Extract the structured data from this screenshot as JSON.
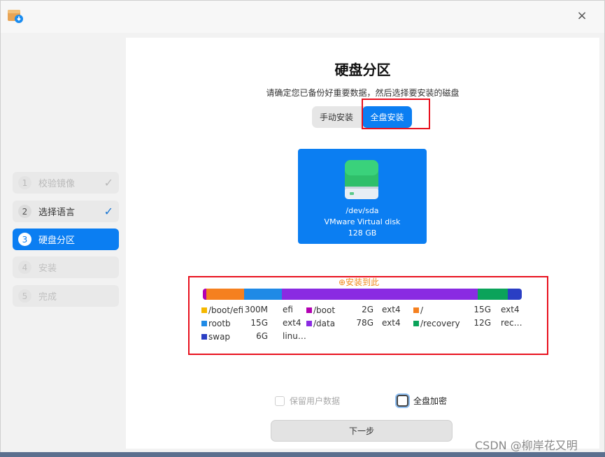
{
  "window": {
    "close_glyph": "×",
    "app_icon": "installer-package-icon"
  },
  "sidebar": {
    "steps": [
      {
        "num": "1",
        "label": "校验镜像",
        "state": "done"
      },
      {
        "num": "2",
        "label": "选择语言",
        "state": "done"
      },
      {
        "num": "3",
        "label": "硬盘分区",
        "state": "active"
      },
      {
        "num": "4",
        "label": "安装",
        "state": "disabled"
      },
      {
        "num": "5",
        "label": "完成",
        "state": "disabled"
      }
    ],
    "check_glyph": "✓"
  },
  "main": {
    "title": "硬盘分区",
    "subtitle": "请确定您已备份好重要数据，然后选择要安装的磁盘",
    "modes": {
      "manual": "手动安装",
      "full": "全盘安装",
      "selected": "全盘安装"
    },
    "disk": {
      "path": "/dev/sda",
      "model": "VMware Virtual disk",
      "size": "128 GB"
    },
    "install_here": "⊕安装到此",
    "partitions": [
      {
        "name": "/boot/efi",
        "size": "300M",
        "fs": "efi",
        "color": "#f5b800",
        "fraction": 0.013
      },
      {
        "name": "/boot",
        "size": "2G",
        "fs": "ext4",
        "color": "#b300b3",
        "fraction": 0.0
      },
      {
        "name": "/",
        "size": "15G",
        "fs": "ext4",
        "color": "#f5801f",
        "fraction": 0.118
      },
      {
        "name": "rootb",
        "size": "15G",
        "fs": "ext4",
        "color": "#1f8ae6",
        "fraction": 0.118
      },
      {
        "name": "/data",
        "size": "78G",
        "fs": "ext4",
        "color": "#8a2be2",
        "fraction": 0.613
      },
      {
        "name": "/recovery",
        "size": "12G",
        "fs": "rec…",
        "color": "#0ba35a",
        "fraction": 0.094
      },
      {
        "name": "swap",
        "size": "6G",
        "fs": "linu…",
        "color": "#2a3ec4",
        "fraction": 0.047
      }
    ],
    "options": {
      "keep_user_data": "保留用户数据",
      "full_disk_encrypt": "全盘加密"
    },
    "next_button": "下一步"
  },
  "watermark": "CSDN @柳岸花又明"
}
